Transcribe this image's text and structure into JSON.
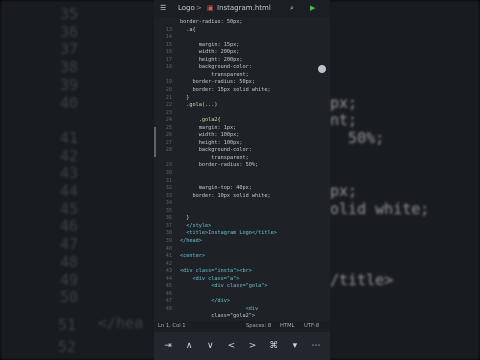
{
  "app": {
    "project": "Logo",
    "filename": "Instagram.html"
  },
  "background_view": {
    "lines": [
      {
        "num": "35",
        "code": ""
      },
      {
        "num": "36",
        "code": ""
      },
      {
        "num": "37",
        "code": ""
      },
      {
        "num": "38",
        "code": ""
      },
      {
        "num": "39",
        "code": ""
      },
      {
        "num": "40",
        "code": "px;"
      },
      {
        "num": "",
        "code": "nt;"
      },
      {
        "num": "41",
        "code": "  50%;"
      },
      {
        "num": "42",
        "code": ""
      },
      {
        "num": "43",
        "code": ""
      },
      {
        "num": "44",
        "code": "px;"
      },
      {
        "num": "45",
        "code": "olid white;"
      },
      {
        "num": "46",
        "code": ""
      },
      {
        "num": "47",
        "code": ""
      },
      {
        "num": "48",
        "code": ""
      },
      {
        "num": "49",
        "code": "/title>"
      },
      {
        "num": "50",
        "code": ""
      }
    ],
    "bottom_text": "</hea",
    "bottom_nums": [
      "51",
      "52"
    ]
  },
  "code": [
    {
      "num": "",
      "text": "border-radius: 50px;"
    },
    {
      "num": "13",
      "text": "  .a{"
    },
    {
      "num": "14",
      "text": ""
    },
    {
      "num": "15",
      "text": "      margin: 15px;"
    },
    {
      "num": "16",
      "text": "      width: 200px;"
    },
    {
      "num": "17",
      "text": "      height: 200px;"
    },
    {
      "num": "18",
      "text": "      background-color:"
    },
    {
      "num": "",
      "text": "          transparent;"
    },
    {
      "num": "19",
      "text": "    border-radius: 50px;"
    },
    {
      "num": "20",
      "text": "    border: 15px solid white;"
    },
    {
      "num": "21",
      "text": "  }"
    },
    {
      "num": "22",
      "text": "  .gola(...)"
    },
    {
      "num": "23",
      "text": ""
    },
    {
      "num": "24",
      "text": "      .gola2{"
    },
    {
      "num": "25",
      "text": "      margin: 1px;"
    },
    {
      "num": "26",
      "text": "      width: 100px;"
    },
    {
      "num": "27",
      "text": "      height: 100px;"
    },
    {
      "num": "28",
      "text": "      background-color:"
    },
    {
      "num": "",
      "text": "          transparent;"
    },
    {
      "num": "29",
      "text": "      border-radius: 50%;"
    },
    {
      "num": "30",
      "text": ""
    },
    {
      "num": "31",
      "text": ""
    },
    {
      "num": "32",
      "text": "      margin-top: 40px;"
    },
    {
      "num": "33",
      "text": "    border: 10px solid white;"
    },
    {
      "num": "34",
      "text": ""
    },
    {
      "num": "35",
      "text": ""
    },
    {
      "num": "36",
      "text": "  }"
    },
    {
      "num": "37",
      "text": "  </style>"
    },
    {
      "num": "38",
      "text": "  <title>Instagram Logo</title>"
    },
    {
      "num": "39",
      "text": "</head>"
    },
    {
      "num": "40",
      "text": ""
    },
    {
      "num": "41",
      "text": "<center>"
    },
    {
      "num": "42",
      "text": ""
    },
    {
      "num": "43",
      "text": "<div class=\"insta\"><br>"
    },
    {
      "num": "44",
      "text": "    <div class=\"a\">"
    },
    {
      "num": "45",
      "text": "          <div class=\"gola\">"
    },
    {
      "num": "46",
      "text": ""
    },
    {
      "num": "47",
      "text": "          </div>"
    },
    {
      "num": "48",
      "text": "                     <div"
    },
    {
      "num": "",
      "text": "          class=\"gola2\">"
    }
  ],
  "status": {
    "position": "Ln 1, Col 1",
    "spaces": "Spaces: 8",
    "language": "HTML",
    "encoding": "UTF-8"
  },
  "keys": [
    {
      "name": "tab-key",
      "glyph": "⇥"
    },
    {
      "name": "up-arrow-key",
      "glyph": "∧"
    },
    {
      "name": "down-arrow-key",
      "glyph": "∨"
    },
    {
      "name": "left-arrow-key",
      "glyph": "<"
    },
    {
      "name": "right-arrow-key",
      "glyph": ">"
    },
    {
      "name": "command-key",
      "glyph": "⌘"
    },
    {
      "name": "dropdown-key",
      "glyph": "▾"
    },
    {
      "name": "more-key",
      "glyph": "⋯"
    }
  ]
}
